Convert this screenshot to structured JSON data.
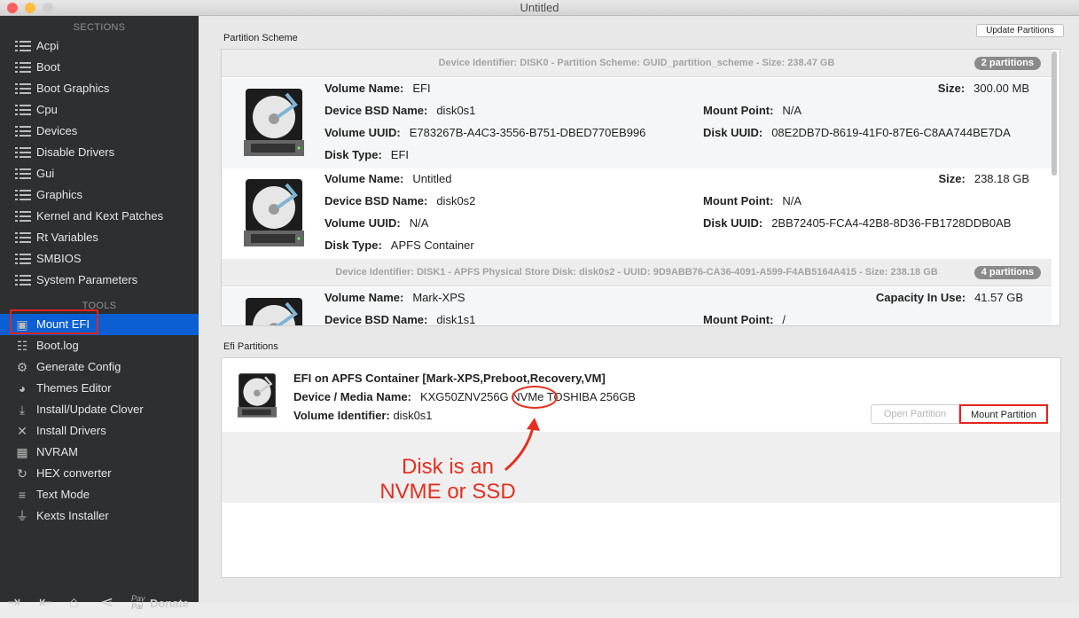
{
  "window": {
    "title": "Untitled"
  },
  "sidebar": {
    "sections_label": "SECTIONS",
    "sections": [
      "Acpi",
      "Boot",
      "Boot Graphics",
      "Cpu",
      "Devices",
      "Disable Drivers",
      "Gui",
      "Graphics",
      "Kernel and Kext Patches",
      "Rt Variables",
      "SMBIOS",
      "System Parameters"
    ],
    "tools_label": "TOOLS",
    "tools": [
      {
        "label": "Mount EFI",
        "icon": "mount-efi-icon",
        "glyph": "▣",
        "selected": true
      },
      {
        "label": "Boot.log",
        "icon": "log-search-icon",
        "glyph": "☷"
      },
      {
        "label": "Generate Config",
        "icon": "gears-icon",
        "glyph": "⚙"
      },
      {
        "label": "Themes Editor",
        "icon": "palette-icon",
        "glyph": "◕"
      },
      {
        "label": "Install/Update Clover",
        "icon": "download-icon",
        "glyph": "⤓"
      },
      {
        "label": "Install Drivers",
        "icon": "tools-icon",
        "glyph": "✕"
      },
      {
        "label": "NVRAM",
        "icon": "chip-icon",
        "glyph": "▦"
      },
      {
        "label": "HEX converter",
        "icon": "refresh-icon",
        "glyph": "↻"
      },
      {
        "label": "Text Mode",
        "icon": "text-lines-icon",
        "glyph": "≡"
      },
      {
        "label": "Kexts Installer",
        "icon": "plug-icon",
        "glyph": "⏚"
      }
    ],
    "bottom": {
      "donate_label": "Donate",
      "paypal": "Pay Pal"
    }
  },
  "partition_scheme": {
    "label": "Partition Scheme",
    "update_button": "Update Partitions",
    "devices": [
      {
        "header": "Device Identifier: DISK0 - Partition Scheme: GUID_partition_scheme - Size: 238.47 GB",
        "badge": "2 partitions",
        "partitions": [
          {
            "volume_name": "EFI",
            "bsd_name": "disk0s1",
            "volume_uuid": "E783267B-A4C3-3556-B751-DBED770EB996",
            "disk_type": "EFI",
            "size": "300.00 MB",
            "mount_point": "N/A",
            "disk_uuid": "08E2DB7D-8619-41F0-87E6-C8AA744BE7DA"
          },
          {
            "volume_name": "Untitled",
            "bsd_name": "disk0s2",
            "volume_uuid": "N/A",
            "disk_type": "APFS Container",
            "size": "238.18 GB",
            "mount_point": "N/A",
            "disk_uuid": "2BB72405-FCA4-42B8-8D36-FB1728DDB0AB"
          }
        ]
      },
      {
        "header": "Device Identifier: DISK1 - APFS Physical Store Disk: disk0s2 - UUID: 9D9ABB76-CA36-4091-A599-F4AB5164A415 - Size: 238.18 GB",
        "badge": "4 partitions",
        "partitions": [
          {
            "volume_name": "Mark-XPS",
            "bsd_name": "disk1s1",
            "capacity_in_use": "41.57 GB",
            "mount_point": "/"
          }
        ]
      }
    ],
    "labels": {
      "volume_name": "Volume Name:",
      "bsd_name": "Device BSD Name:",
      "volume_uuid": "Volume UUID:",
      "disk_type": "Disk Type:",
      "size": "Size:",
      "mount_point": "Mount Point:",
      "disk_uuid": "Disk UUID:",
      "capacity_in_use": "Capacity In Use:"
    }
  },
  "efi_partitions": {
    "label": "Efi Partitions",
    "title": "EFI on APFS Container [Mark-XPS,Preboot,Recovery,VM]",
    "media_label": "Device / Media Name:",
    "media_value": "KXG50ZNV256G NVMe TOSHIBA 256GB",
    "volume_id_label": "Volume Identifier:",
    "volume_id_value": "disk0s1",
    "open_button": "Open Partition",
    "mount_button": "Mount Partition"
  },
  "annotation": {
    "line1": "Disk is an",
    "line2": "NVME or SSD",
    "color": "#e3301f"
  }
}
